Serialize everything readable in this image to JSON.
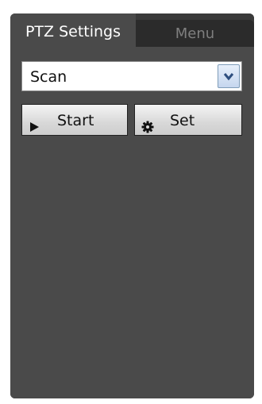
{
  "tabs": {
    "active": "PTZ Settings",
    "inactive": "Menu"
  },
  "select": {
    "value": "Scan"
  },
  "buttons": {
    "start": {
      "label": "Start",
      "icon": "play-icon"
    },
    "set": {
      "label": "Set",
      "icon": "gear-icon"
    }
  },
  "colors": {
    "panel_bg": "#4a4a4a",
    "tab_bar_bg": "#3a3a3a",
    "inactive_tab_bg": "#2b2b2b"
  }
}
